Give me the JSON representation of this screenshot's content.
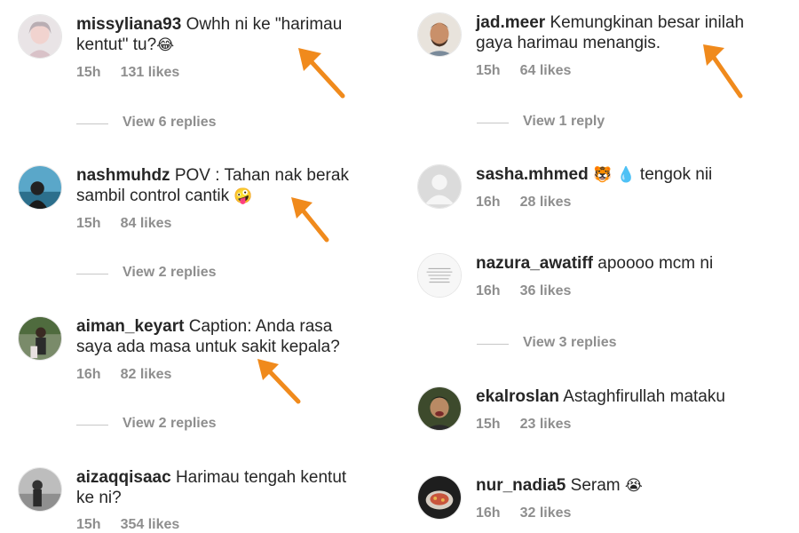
{
  "accent": "#f08a1c",
  "left": {
    "comments": [
      {
        "username": "missyliana93",
        "line1": "Owhh ni ke \"harimau",
        "line2": "kentut\" tu?",
        "emoji": "😂",
        "time": "15h",
        "likes": "131 likes",
        "replies": "View 6 replies"
      },
      {
        "username": "nashmuhdz",
        "line1": "POV : Tahan nak berak",
        "line2": "sambil control cantik",
        "emoji": "🤪",
        "time": "15h",
        "likes": "84 likes",
        "replies": "View 2 replies"
      },
      {
        "username": "aiman_keyart",
        "line1": "Caption: Anda rasa",
        "line2": "saya ada masa untuk sakit kepala?",
        "time": "16h",
        "likes": "82 likes",
        "replies": "View 2 replies"
      },
      {
        "username": "aizaqqisaac",
        "line1": "Harimau tengah kentut",
        "line2": "ke ni?",
        "time": "15h",
        "likes": "354 likes"
      }
    ]
  },
  "right": {
    "comments": [
      {
        "username": "jad.meer",
        "line1": "Kemungkinan besar inilah",
        "line2": "gaya harimau menangis.",
        "time": "15h",
        "likes": "64 likes",
        "replies": "View 1 reply"
      },
      {
        "username": "sasha.mhmed",
        "emoji1": "🐯",
        "emoji2": "💧",
        "line1": "tengok nii",
        "time": "16h",
        "likes": "28 likes"
      },
      {
        "username": "nazura_awatiff",
        "line1": "apoooo mcm ni",
        "time": "16h",
        "likes": "36 likes",
        "replies": "View 3 replies"
      },
      {
        "username": "ekalroslan",
        "line1": "Astaghfirullah mataku",
        "time": "15h",
        "likes": "23 likes"
      },
      {
        "username": "nur_nadia5",
        "line1": "Seram",
        "emoji": "😭",
        "time": "16h",
        "likes": "32 likes"
      }
    ]
  },
  "icons": {
    "arrow": "arrow-pointer-icon",
    "default_avatar": "default-profile-icon"
  }
}
